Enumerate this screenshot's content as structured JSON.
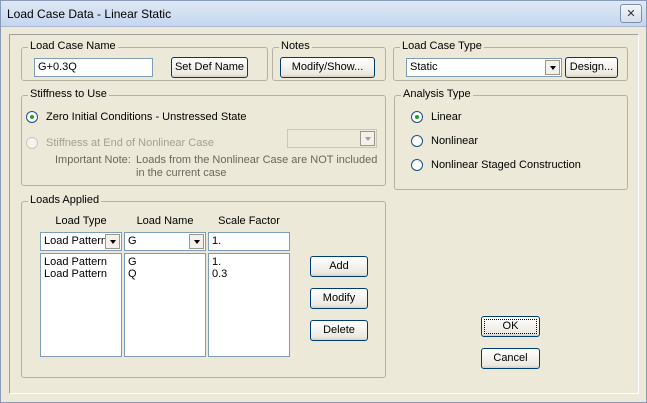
{
  "window": {
    "title": "Load Case Data - Linear Static",
    "close_glyph": "✕"
  },
  "load_case_name": {
    "group_label": "Load Case Name",
    "value": "G+0.3Q",
    "set_def_button": "Set Def Name"
  },
  "notes": {
    "group_label": "Notes",
    "button": "Modify/Show..."
  },
  "load_case_type": {
    "group_label": "Load Case Type",
    "selected": "Static",
    "design_button": "Design..."
  },
  "stiffness": {
    "group_label": "Stiffness to Use",
    "option_zero": "Zero Initial Conditions - Unstressed State",
    "option_end": "Stiffness at End of Nonlinear Case",
    "note_label": "Important Note:",
    "note_text": "Loads from the Nonlinear Case are NOT included in the current case",
    "selected": "zero"
  },
  "analysis_type": {
    "group_label": "Analysis Type",
    "options": [
      "Linear",
      "Nonlinear",
      "Nonlinear Staged Construction"
    ],
    "selected": "Linear"
  },
  "loads_applied": {
    "group_label": "Loads Applied",
    "headers": {
      "load_type": "Load Type",
      "load_name": "Load Name",
      "scale_factor": "Scale Factor"
    },
    "edit_row": {
      "load_type": "Load Pattern",
      "load_name": "G",
      "scale_factor": "1."
    },
    "rows": [
      {
        "load_type": "Load Pattern",
        "load_name": "G",
        "scale_factor": "1."
      },
      {
        "load_type": "Load Pattern",
        "load_name": "Q",
        "scale_factor": "0.3"
      }
    ],
    "buttons": {
      "add": "Add",
      "modify": "Modify",
      "delete": "Delete"
    }
  },
  "dialog_buttons": {
    "ok": "OK",
    "cancel": "Cancel"
  }
}
